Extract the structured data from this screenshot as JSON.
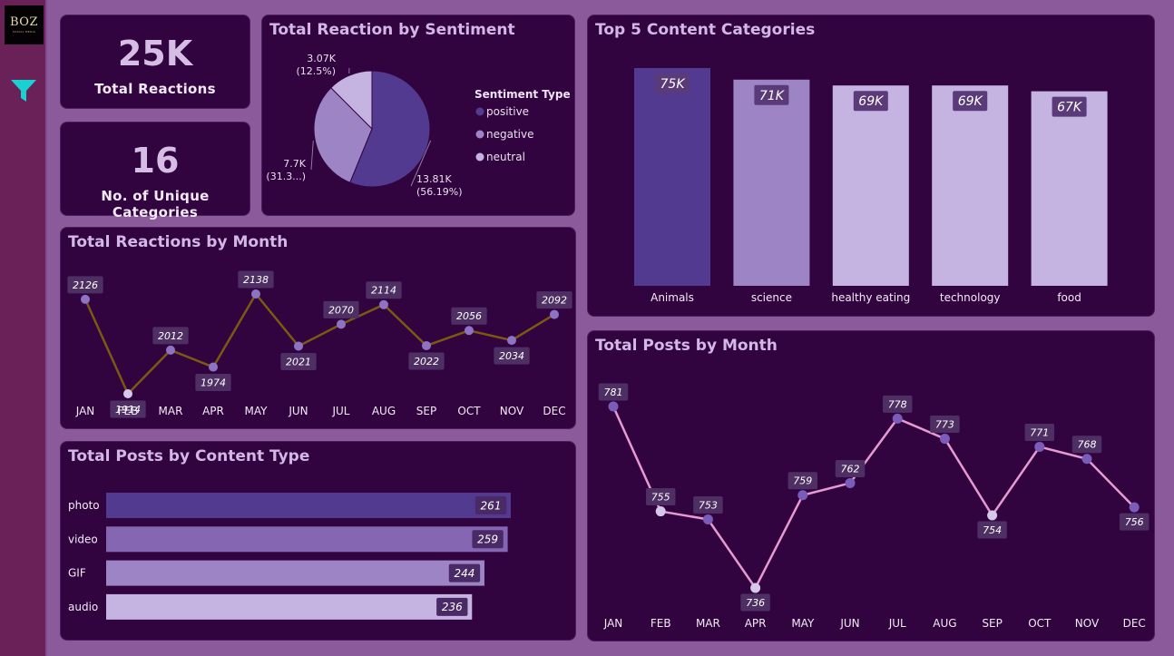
{
  "sidebar": {
    "logo_text": "BOZ",
    "logo_subtext": "SOCIAL MEDIA"
  },
  "kpi": {
    "total_reactions": {
      "value": "25K",
      "label": "Total Reactions"
    },
    "unique_categories": {
      "value": "16",
      "label": "No. of Unique Categories"
    }
  },
  "colors": {
    "background": "#8a5a9a",
    "card": "#32043f",
    "positive": "#533a91",
    "negative": "#9d84c4",
    "neutral": "#c5b4e2",
    "reactions_line": "#7a5a10",
    "posts_line": "#e79ad2",
    "filter_icon": "#1ad1d1"
  },
  "icons": {
    "filter": "filter-funnel-icon"
  },
  "chart_data": [
    {
      "id": "sentiment_pie",
      "type": "pie",
      "title": "Total Reaction by Sentiment",
      "legend_title": "Sentiment Type",
      "legend_position": "right",
      "slices": [
        {
          "name": "positive",
          "value": 13810,
          "label": "13.81K",
          "pct_label": "(56.19%)"
        },
        {
          "name": "negative",
          "value": 7700,
          "label": "7.7K",
          "pct_label": "(31.3...)"
        },
        {
          "name": "neutral",
          "value": 3070,
          "label": "3.07K",
          "pct_label": "(12.5%)"
        }
      ]
    },
    {
      "id": "top_categories",
      "type": "bar",
      "title": "Top 5 Content Categories",
      "categories": [
        "Animals",
        "science",
        "healthy eating",
        "technology",
        "food"
      ],
      "values": [
        75,
        71,
        69,
        69,
        67
      ],
      "value_labels": [
        "75K",
        "71K",
        "69K",
        "69K",
        "67K"
      ],
      "ylim": [
        0,
        75
      ]
    },
    {
      "id": "reactions_by_month",
      "type": "line",
      "title": "Total Reactions by Month",
      "categories": [
        "JAN",
        "FEB",
        "MAR",
        "APR",
        "MAY",
        "JUN",
        "JUL",
        "AUG",
        "SEP",
        "OCT",
        "NOV",
        "DEC"
      ],
      "values": [
        2126,
        1914,
        2012,
        1974,
        2138,
        2021,
        2070,
        2114,
        2022,
        2056,
        2034,
        2092
      ],
      "ylim": [
        1914,
        2138
      ]
    },
    {
      "id": "posts_by_content_type",
      "type": "bar",
      "orientation": "horizontal",
      "title": "Total Posts by Content Type",
      "categories": [
        "photo",
        "video",
        "GIF",
        "audio"
      ],
      "values": [
        261,
        259,
        244,
        236
      ],
      "xlim": [
        0,
        261
      ]
    },
    {
      "id": "posts_by_month",
      "type": "line",
      "title": "Total Posts by Month",
      "categories": [
        "JAN",
        "FEB",
        "MAR",
        "APR",
        "MAY",
        "JUN",
        "JUL",
        "AUG",
        "SEP",
        "OCT",
        "NOV",
        "DEC"
      ],
      "values": [
        781,
        755,
        753,
        736,
        759,
        762,
        778,
        773,
        754,
        771,
        768,
        756
      ],
      "ylim": [
        736,
        781
      ]
    }
  ]
}
